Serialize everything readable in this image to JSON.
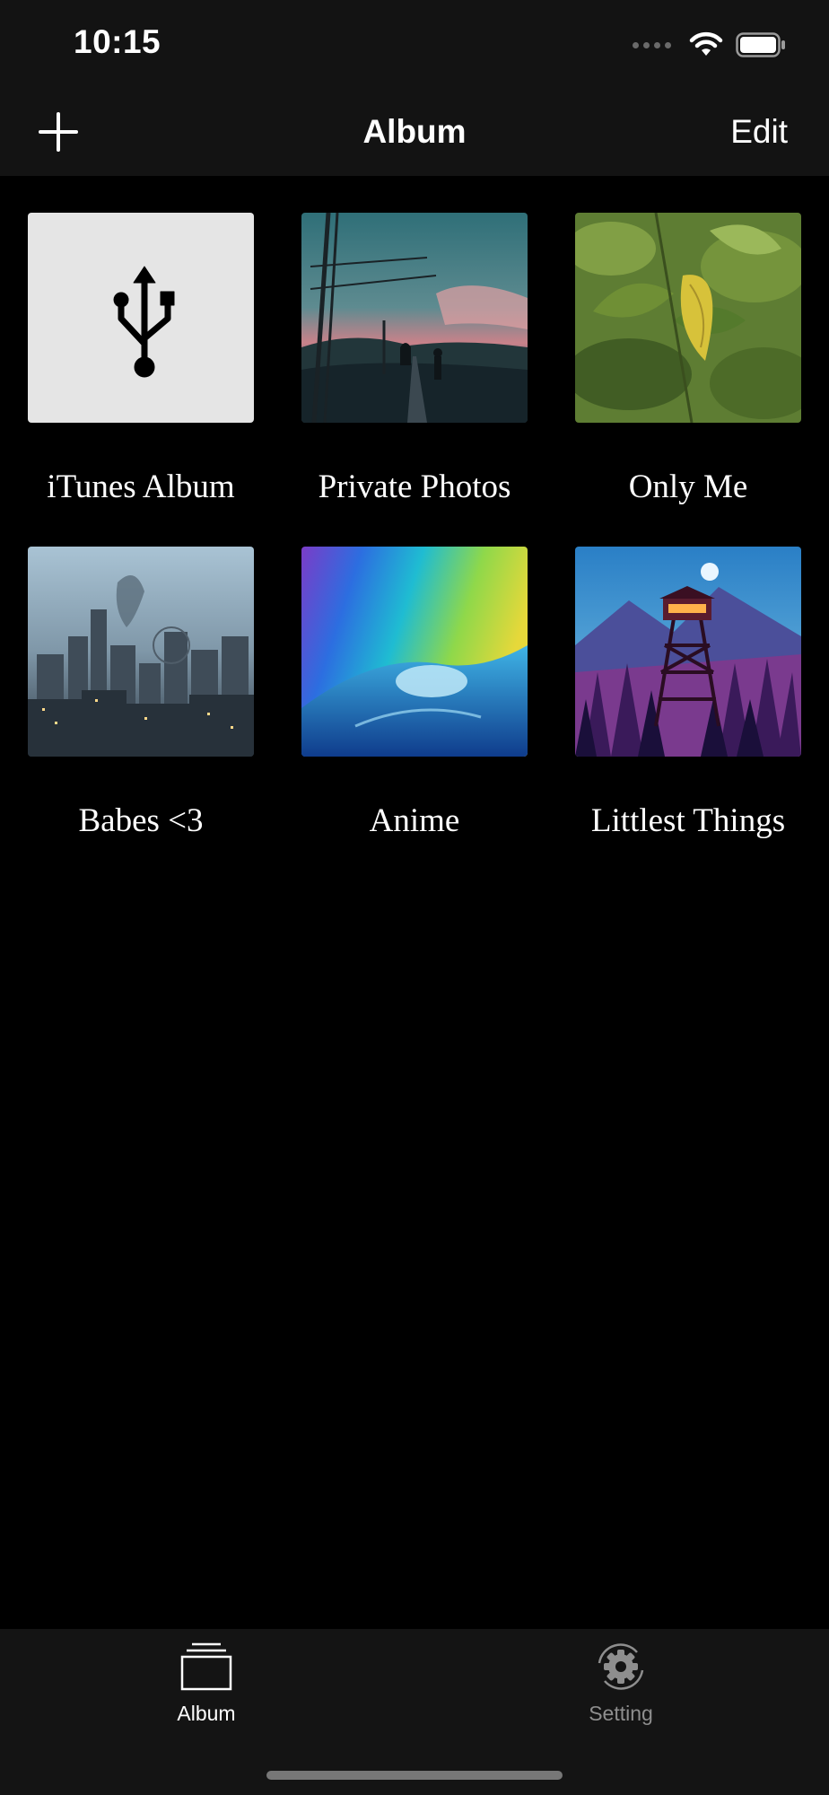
{
  "status_bar": {
    "time": "10:15",
    "icons": [
      "signal-dots-icon",
      "wifi-icon",
      "battery-icon"
    ]
  },
  "nav_bar": {
    "add_icon": "plus-icon",
    "title": "Album",
    "edit_label": "Edit"
  },
  "albums": [
    {
      "name": "iTunes Album",
      "thumbnail": "usb-icon"
    },
    {
      "name": "Private Photos",
      "thumbnail": "twilight-railway-image"
    },
    {
      "name": "Only Me",
      "thumbnail": "green-leaves-image"
    },
    {
      "name": "Babes <3",
      "thumbnail": "city-skyline-image"
    },
    {
      "name": "Anime",
      "thumbnail": "rainbow-wave-image"
    },
    {
      "name": "Littlest Things",
      "thumbnail": "fire-lookout-tower-image"
    }
  ],
  "tab_bar": {
    "tabs": [
      {
        "label": "Album",
        "icon": "album-stack-icon",
        "active": true
      },
      {
        "label": "Setting",
        "icon": "gear-icon",
        "active": false
      }
    ]
  },
  "colors": {
    "background": "#000000",
    "bar_background": "#131313",
    "active_tab": "#ffffff",
    "inactive_tab": "#8e8e8e"
  }
}
